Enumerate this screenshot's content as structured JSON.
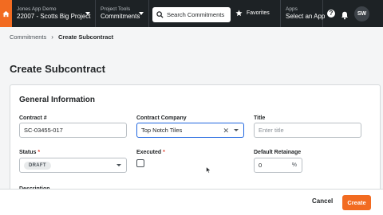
{
  "topnav": {
    "project": {
      "small": "Jones App Demo",
      "main": "22007 - Scotts Big Project"
    },
    "tools": {
      "small": "Project Tools",
      "main": "Commitments"
    },
    "search": {
      "placeholder": "Search Commitments"
    },
    "favorites": "Favorites",
    "apps": {
      "small": "Apps",
      "main": "Select an App"
    },
    "help": "?",
    "avatar": "SW"
  },
  "breadcrumb": {
    "parent": "Commitments",
    "current": "Create Subcontract"
  },
  "page_title": "Create Subcontract",
  "general": {
    "title": "General Information",
    "contract_label": "Contract #",
    "contract_value": "SC-03455-017",
    "company_label": "Contract Company",
    "company_value": "Top Notch Tiles",
    "title_label": "Title",
    "title_placeholder": "Enter title",
    "status_label": "Status",
    "status_value": "DRAFT",
    "executed_label": "Executed",
    "retainage_label": "Default Retainage",
    "retainage_value": "0",
    "retainage_unit": "%",
    "description_label": "Description",
    "required_mark": "*"
  },
  "footer": {
    "cancel": "Cancel",
    "create": "Create"
  },
  "colors": {
    "accent": "#f26b21",
    "nav": "#1d2225",
    "focus": "#2066df"
  }
}
